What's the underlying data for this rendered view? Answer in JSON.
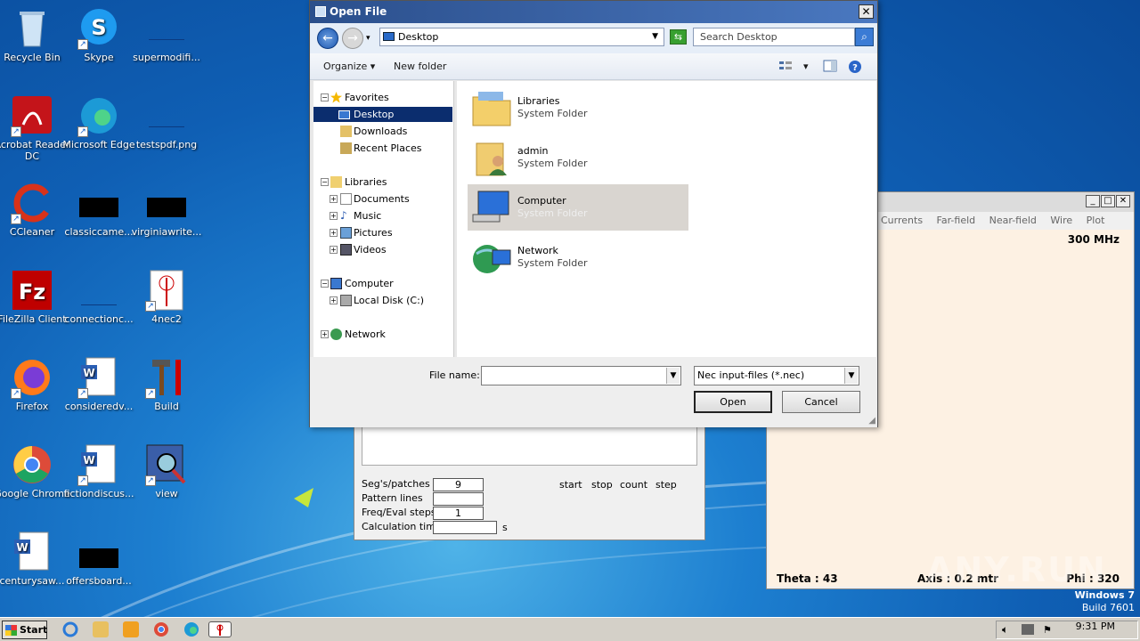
{
  "desktop": {
    "icons": [
      {
        "label": "Recycle Bin"
      },
      {
        "label": "Skype"
      },
      {
        "label": "supermodifi..."
      },
      {
        "label": "Acrobat Reader DC"
      },
      {
        "label": "Microsoft Edge"
      },
      {
        "label": "testspdf.png"
      },
      {
        "label": "CCleaner"
      },
      {
        "label": "classiccame..."
      },
      {
        "label": "virginiawrite..."
      },
      {
        "label": "FileZilla Client"
      },
      {
        "label": "connectionc..."
      },
      {
        "label": "4nec2"
      },
      {
        "label": "Firefox"
      },
      {
        "label": "consideredv..."
      },
      {
        "label": "Build"
      },
      {
        "label": "Google Chrome"
      },
      {
        "label": "fictiondiscus..."
      },
      {
        "label": "view"
      },
      {
        "label": "centurysaw..."
      },
      {
        "label": "offersboard..."
      }
    ]
  },
  "nec_pattern_window": {
    "menu": [
      "Currents",
      "Far-field",
      "Near-field",
      "Wire",
      "Plot"
    ],
    "frequency": "300 MHz",
    "theta": "Theta : 43",
    "axis": "Axis : 0.2 mtr",
    "phi": "Phi : 320"
  },
  "nec_main_window": {
    "rows": [
      {
        "label": "Seg's/patches",
        "value": "9"
      },
      {
        "label": "Pattern lines",
        "value": ""
      },
      {
        "label": "Freq/Eval steps",
        "value": "1"
      },
      {
        "label": "Calculation time",
        "value": ""
      }
    ],
    "unit_s": "s",
    "columns": [
      "start",
      "stop",
      "count",
      "step"
    ]
  },
  "dialog": {
    "title": "Open File",
    "address": "Desktop",
    "search_placeholder": "Search Desktop",
    "organize": "Organize",
    "new_folder": "New folder",
    "nav": {
      "favorites": "Favorites",
      "desktop": "Desktop",
      "downloads": "Downloads",
      "recent": "Recent Places",
      "libraries": "Libraries",
      "documents": "Documents",
      "music": "Music",
      "pictures": "Pictures",
      "videos": "Videos",
      "computer": "Computer",
      "local_disk": "Local Disk (C:)",
      "network": "Network"
    },
    "items": [
      {
        "name": "Libraries",
        "type": "System Folder"
      },
      {
        "name": "admin",
        "type": "System Folder"
      },
      {
        "name": "Computer",
        "type": "System Folder"
      },
      {
        "name": "Network",
        "type": "System Folder"
      }
    ],
    "file_name_label": "File name:",
    "file_name_value": "",
    "file_type": "Nec input-files (*.nec)",
    "open_label": "Open",
    "cancel_label": "Cancel"
  },
  "taskbar": {
    "start_label": "Start",
    "clock": "9:31 PM"
  },
  "os": {
    "name": "Windows 7",
    "build": "Build 7601"
  },
  "watermark": "ANY.RUN"
}
